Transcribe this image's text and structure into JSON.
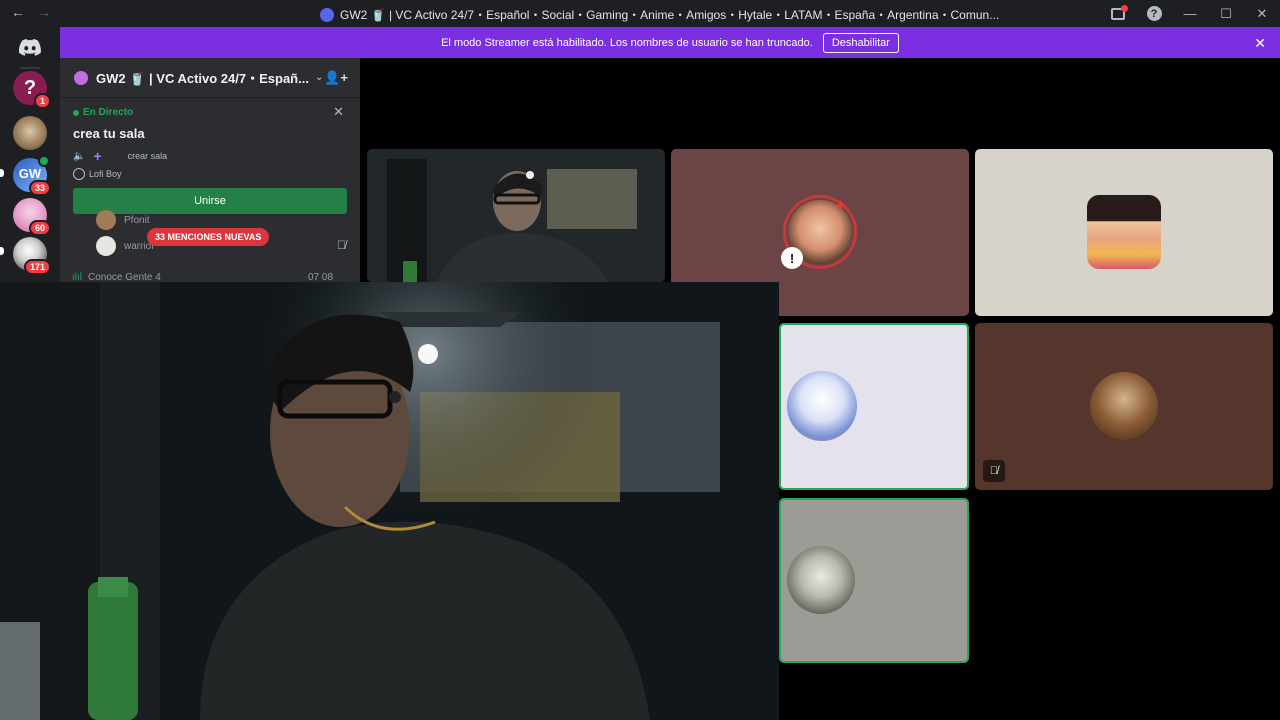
{
  "titlebar": {
    "back_glyph": "←",
    "forward_glyph": "→",
    "title": "GW2 🥤 | VC Activo 24/7・Español・Social・Gaming・Anime・Amigos・Hytale・LATAM・España・Argentina・Comun...",
    "minimize_glyph": "—",
    "maximize_glyph": "☐",
    "close_glyph": "✕",
    "help_glyph": "?"
  },
  "rail": {
    "home_icon": "discord-icon",
    "servers": [
      {
        "name": "question-server",
        "badge": "1",
        "color": "#8a1c54"
      },
      {
        "name": "cat-server",
        "badge": "",
        "color": "#a68b65"
      },
      {
        "name": "gw-server",
        "badge": "33",
        "color": "#4e7fd3"
      },
      {
        "name": "pink-server",
        "badge": "60",
        "color": "#e59ac7"
      },
      {
        "name": "anime-server",
        "badge": "171",
        "color": "#d6d6d6"
      }
    ]
  },
  "banner": {
    "message": "El modo Streamer está habilitado. Los nombres de usuario se han truncado.",
    "button_label": "Deshabilitar",
    "close_glyph": "✕"
  },
  "sidebar": {
    "server_name": "GW2 🥤 | VC Activo 24/7・Españ...",
    "caret_glyph": "⌄",
    "invite_glyph": "👤+",
    "live": {
      "tag": "En Directo",
      "close_glyph": "✕",
      "title": "crea tu sala",
      "voice_icon_glyph": "🔈",
      "plus_glyph": "+",
      "channel_label": "crear sala",
      "activity_label": "Lofi Boy",
      "join_label": "Unirse"
    },
    "members": [
      {
        "name": "Pfonit",
        "color": "#a27a55"
      },
      {
        "name": "warrior",
        "color": "#e8e6e0"
      }
    ],
    "mention_pill": "33 MENCIONES NUEVAS",
    "mute_glyph": "🎙̸",
    "channel": {
      "icon_glyph": "ılıl",
      "label": "Conoce Gente 4",
      "count": "07 08"
    }
  },
  "tiles": {
    "speaking_ring_color": "#23a55a"
  },
  "colors": {
    "banner": "#7c2fe0",
    "join": "#248046",
    "mention": "#da373c",
    "speaking": "#23a55a"
  }
}
